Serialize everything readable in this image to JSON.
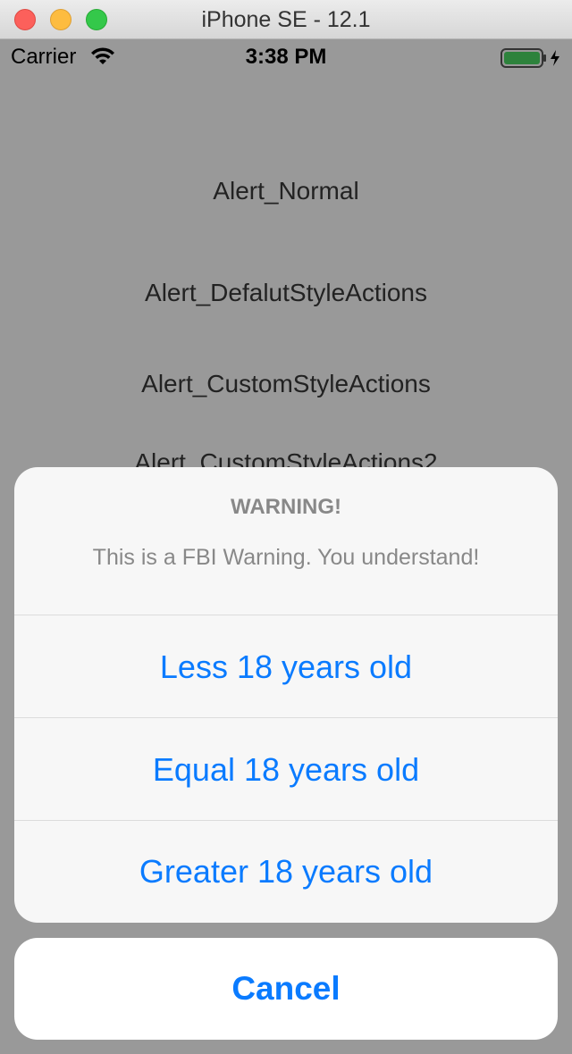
{
  "window": {
    "title": "iPhone SE - 12.1"
  },
  "statusbar": {
    "carrier": "Carrier",
    "time": "3:38 PM",
    "battery_color": "#4cd964"
  },
  "menu": {
    "items": [
      {
        "label": "Alert_Normal"
      },
      {
        "label": "Alert_DefalutStyleActions"
      },
      {
        "label": "Alert_CustomStyleActions"
      },
      {
        "label": "Alert_CustomStyleActions2"
      }
    ]
  },
  "action_sheet": {
    "title": "WARNING!",
    "message": "This is a FBI Warning. You understand!",
    "actions": [
      {
        "label": "Less 18 years old"
      },
      {
        "label": "Equal 18 years old"
      },
      {
        "label": "Greater 18 years old"
      }
    ],
    "cancel_label": "Cancel"
  },
  "colors": {
    "action_blue": "#0a7bff",
    "dim_overlay": "rgba(0,0,0,0.4)"
  }
}
